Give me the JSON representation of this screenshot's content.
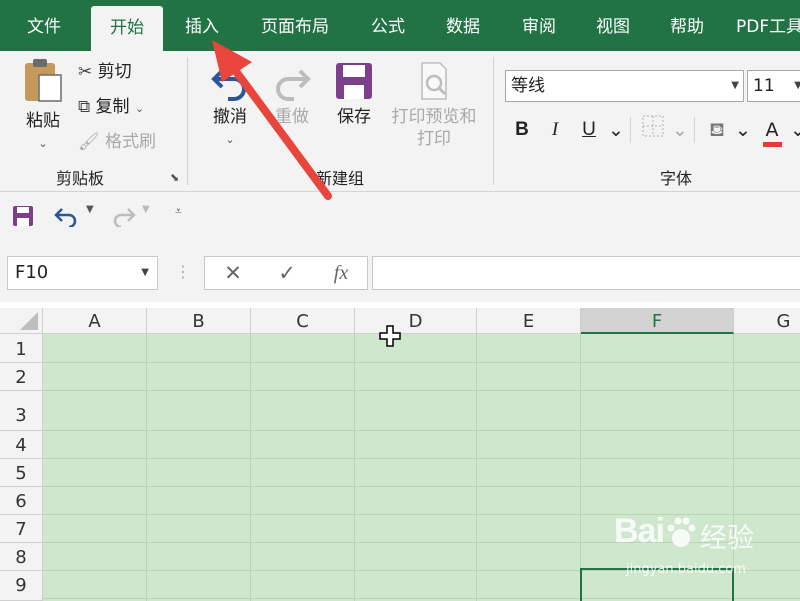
{
  "tabs": [
    "文件",
    "开始",
    "插入",
    "页面布局",
    "公式",
    "数据",
    "审阅",
    "视图",
    "帮助",
    "PDF工具"
  ],
  "active_tab": "开始",
  "clipboard": {
    "paste_label": "粘贴",
    "cut_label": "剪切",
    "copy_label": "复制",
    "format_painter_label": "格式刷",
    "group_label": "剪贴板"
  },
  "new_group": {
    "undo_label": "撤消",
    "redo_label": "重做",
    "save_label": "保存",
    "print_preview_label_line1": "打印预览和",
    "print_preview_label_line2": "打印",
    "group_label": "新建组"
  },
  "font": {
    "font_name": "等线",
    "font_size": "11",
    "bold": "B",
    "italic": "I",
    "underline": "U",
    "font_color_glyph": "A",
    "group_label": "字体"
  },
  "formula_bar": {
    "name_box": "F10",
    "cancel_glyph": "✕",
    "enter_glyph": "✓",
    "fx_label": "fx",
    "value": ""
  },
  "columns": [
    "A",
    "B",
    "C",
    "D",
    "E",
    "F",
    "G"
  ],
  "selected_column": "F",
  "rows": [
    "1",
    "2",
    "3",
    "4",
    "5",
    "6",
    "7",
    "8",
    "9"
  ],
  "selected_cell": "F10",
  "watermark": {
    "brand": "Bai",
    "brand_cn": "经验",
    "url": "jingyan.baidu.com"
  },
  "colors": {
    "ribbon_green": "#217346",
    "cell_fill": "#cfe7cd",
    "arrow_red": "#e8453c",
    "save_purple": "#7b3f8c"
  }
}
